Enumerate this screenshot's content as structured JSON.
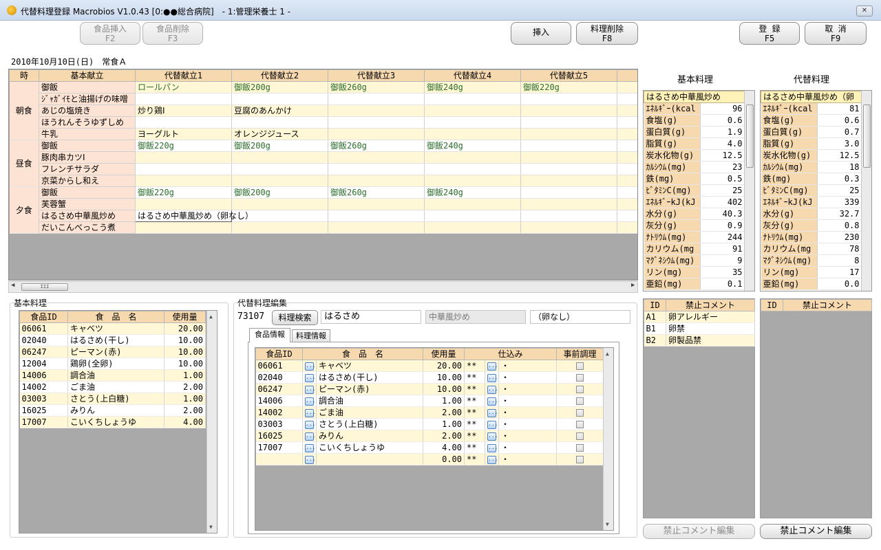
{
  "window": {
    "title": "代替料理登録 Macrobios V1.0.43 [0:●●総合病院]　- 1:管理栄養士 1 -",
    "close": "✕"
  },
  "toolbar": {
    "insert_food": "食品挿入\nF2",
    "delete_food": "食品削除\nF3",
    "insert": "挿入",
    "delete_dish": "料理削除\nF8",
    "register": "登 録\nF5",
    "cancel": "取 消\nF9"
  },
  "date_label": "2010年10月10日(日)　常食Ａ",
  "menu_grid": {
    "headers": [
      "時",
      "基本献立",
      "代替献立1",
      "代替献立2",
      "代替献立3",
      "代替献立4",
      "代替献立5"
    ],
    "meals": [
      {
        "name": "朝食",
        "rows": [
          {
            "base": "御飯",
            "alts": [
              "ロールパン",
              "御飯200g",
              "御飯260g",
              "御飯240g",
              "御飯220g"
            ]
          },
          {
            "base": "ｼﾞｬｶﾞｲﾓと油揚げの味噌",
            "alts": [
              "",
              "",
              "",
              "",
              ""
            ]
          },
          {
            "base": "あじの塩焼き",
            "alts": [
              "炒り鶏Ⅰ",
              "豆腐のあんかけ",
              "",
              "",
              ""
            ]
          },
          {
            "base": "ほうれんそうゆずしめ",
            "alts": [
              "",
              "",
              "",
              "",
              ""
            ]
          },
          {
            "base": "牛乳",
            "alts": [
              "ヨーグルト",
              "オレンジジュース",
              "",
              "",
              ""
            ]
          }
        ]
      },
      {
        "name": "昼食",
        "rows": [
          {
            "base": "御飯",
            "alts": [
              "御飯220g",
              "御飯200g",
              "御飯260g",
              "御飯240g",
              ""
            ]
          },
          {
            "base": "豚肉串カツⅠ",
            "alts": [
              "",
              "",
              "",
              "",
              ""
            ]
          },
          {
            "base": "フレンチサラダ",
            "alts": [
              "",
              "",
              "",
              "",
              ""
            ]
          },
          {
            "base": "京菜からし和え",
            "alts": [
              "",
              "",
              "",
              "",
              ""
            ]
          }
        ]
      },
      {
        "name": "夕食",
        "rows": [
          {
            "base": "御飯",
            "alts": [
              "御飯220g",
              "御飯200g",
              "御飯260g",
              "御飯240g",
              ""
            ]
          },
          {
            "base": "芙蓉蟹",
            "alts": [
              "",
              "",
              "",
              "",
              ""
            ]
          },
          {
            "base": "はるさめ中華風炒め",
            "alts": [
              "はるさめ中華風炒め（卵なし）",
              "",
              "",
              "",
              ""
            ]
          },
          {
            "base": "だいこんべっこう煮",
            "alts": [
              "",
              "",
              "",
              "",
              ""
            ]
          }
        ]
      }
    ]
  },
  "nutrition": {
    "base_title": "基本料理",
    "alt_title": "代替料理",
    "base_dish": "はるさめ中華風炒め",
    "alt_dish": "はるさめ中華風炒め（卵",
    "labels": [
      "ｴﾈﾙｷﾞｰ(kcal",
      "食塩(g)",
      "蛋白質(g)",
      "脂質(g)",
      "炭水化物(g)",
      "ｶﾙｼｳﾑ(mg)",
      "鉄(mg)",
      "ﾋﾞﾀﾐﾝC(mg)",
      "ｴﾈﾙｷﾞｰkJ(kJ",
      "水分(g)",
      "灰分(g)",
      "ﾅﾄﾘｳﾑ(mg)",
      "カリウム(mg",
      "ﾏｸﾞﾈｼｳﾑ(mg)",
      "リン(mg)",
      "亜鉛(mg)"
    ],
    "base_values": [
      "96",
      "0.6",
      "1.9",
      "4.0",
      "12.5",
      "23",
      "0.5",
      "25",
      "402",
      "40.3",
      "0.9",
      "244",
      "91",
      "9",
      "35",
      "0.1"
    ],
    "alt_values": [
      "81",
      "0.6",
      "0.7",
      "3.0",
      "12.5",
      "18",
      "0.3",
      "25",
      "339",
      "32.7",
      "0.8",
      "230",
      "78",
      "8",
      "17",
      "0.0"
    ]
  },
  "prohibited": {
    "headers": [
      "ID",
      "禁止コメント"
    ],
    "base_rows": [
      [
        "A1",
        "卵アレルギー"
      ],
      [
        "B1",
        "卵禁"
      ],
      [
        "B2",
        "卵製品禁"
      ]
    ],
    "edit_base": "禁止コメント編集",
    "edit_alt": "禁止コメント編集"
  },
  "base_dish": {
    "title": "基本料理",
    "headers": [
      "食品ID",
      "食　品　名",
      "使用量"
    ],
    "rows": [
      [
        "06061",
        "キャベツ",
        "20.00"
      ],
      [
        "02040",
        "はるさめ(干し)",
        "10.00"
      ],
      [
        "06247",
        "ピーマン(赤)",
        "10.00"
      ],
      [
        "12004",
        "鶏卵(全卵)",
        "10.00"
      ],
      [
        "14006",
        "調合油",
        "1.00"
      ],
      [
        "14002",
        "ごま油",
        "2.00"
      ],
      [
        "03003",
        "さとう(上白糖)",
        "1.00"
      ],
      [
        "16025",
        "みりん",
        "2.00"
      ],
      [
        "17007",
        "こいくちしょうゆ",
        "4.00"
      ]
    ]
  },
  "alt_edit": {
    "title": "代替料理編集",
    "code": "73107",
    "search_btn": "料理検索",
    "name1": "はるさめ",
    "name2": "中華風炒め",
    "name3": "（卵なし）",
    "tabs": [
      "食品情報",
      "料理情報"
    ],
    "headers": [
      "食品ID",
      "食　品　名",
      "使用量",
      "仕込み",
      "事前調理"
    ],
    "rows": [
      [
        "06061",
        "キャベツ",
        "20.00"
      ],
      [
        "02040",
        "はるさめ(干し)",
        "10.00"
      ],
      [
        "06247",
        "ピーマン(赤)",
        "10.00"
      ],
      [
        "14006",
        "調合油",
        "1.00"
      ],
      [
        "14002",
        "ごま油",
        "2.00"
      ],
      [
        "03003",
        "さとう(上白糖)",
        "1.00"
      ],
      [
        "16025",
        "みりん",
        "2.00"
      ],
      [
        "17007",
        "こいくちしょうゆ",
        "4.00"
      ],
      [
        "",
        "",
        "0.00"
      ]
    ],
    "unit": "**",
    "prep": "・"
  }
}
